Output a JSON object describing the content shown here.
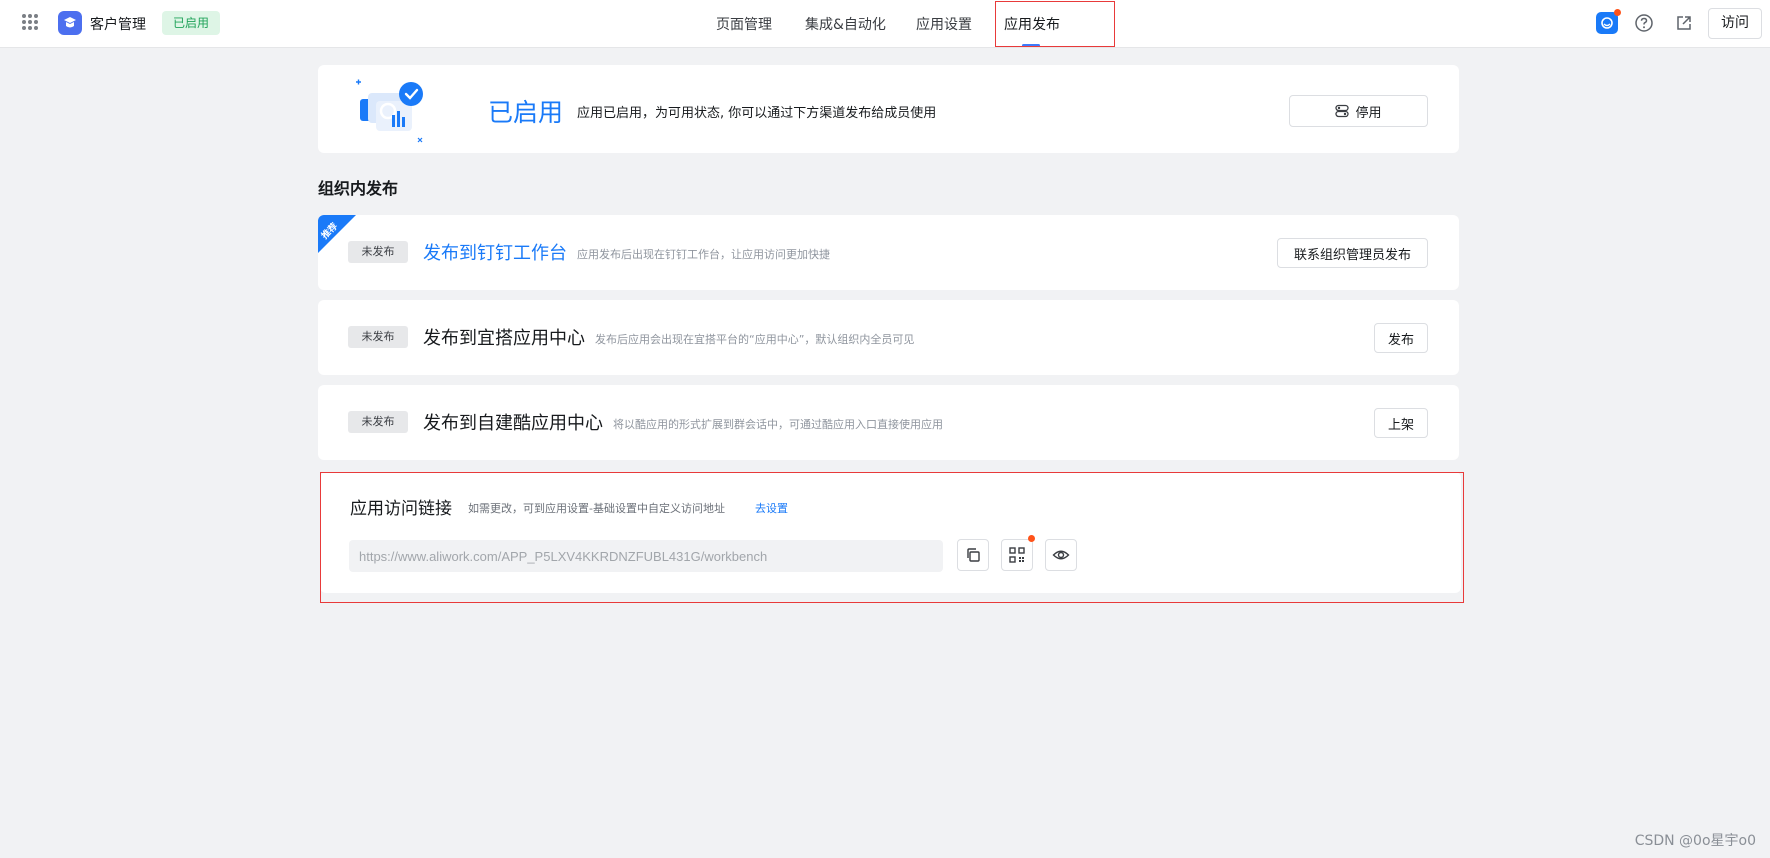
{
  "header": {
    "app_name": "客户管理",
    "app_status": "已启用",
    "nav": [
      {
        "label": "页面管理"
      },
      {
        "label": "集成&自动化"
      },
      {
        "label": "应用设置"
      },
      {
        "label": "应用发布",
        "active": true
      }
    ],
    "visit_label": "访问"
  },
  "status_card": {
    "title": "已启用",
    "description": "应用已启用，为可用状态, 你可以通过下方渠道发布给成员使用",
    "disable_label": "停用"
  },
  "section_title": "组织内发布",
  "publish_rows": [
    {
      "ribbon": "推荐",
      "badge": "未发布",
      "title": "发布到钉钉工作台",
      "description": "应用发布后出现在钉钉工作台，让应用访问更加快捷",
      "action": "联系组织管理员发布"
    },
    {
      "badge": "未发布",
      "title": "发布到宜搭应用中心",
      "description": "发布后应用会出现在宜搭平台的“应用中心”，默认组织内全员可见",
      "action": "发布"
    },
    {
      "badge": "未发布",
      "title": "发布到自建酷应用中心",
      "description": "将以酷应用的形式扩展到群会话中，可通过酷应用入口直接使用应用",
      "action": "上架"
    }
  ],
  "access_link": {
    "title": "应用访问链接",
    "description": "如需更改，可到应用设置-基础设置中自定义访问地址",
    "action_label": "去设置",
    "url": "https://www.aliwork.com/APP_P5LXV4KKRDNZFUBL431G/workbench"
  },
  "watermark": "CSDN @0o星宇o0",
  "colors": {
    "accent": "#1a7af8",
    "nav_underline": "#3e7bfa",
    "status_green": "#21a35a",
    "notification": "#ff5219",
    "highlight_box": "#e83a3a"
  }
}
